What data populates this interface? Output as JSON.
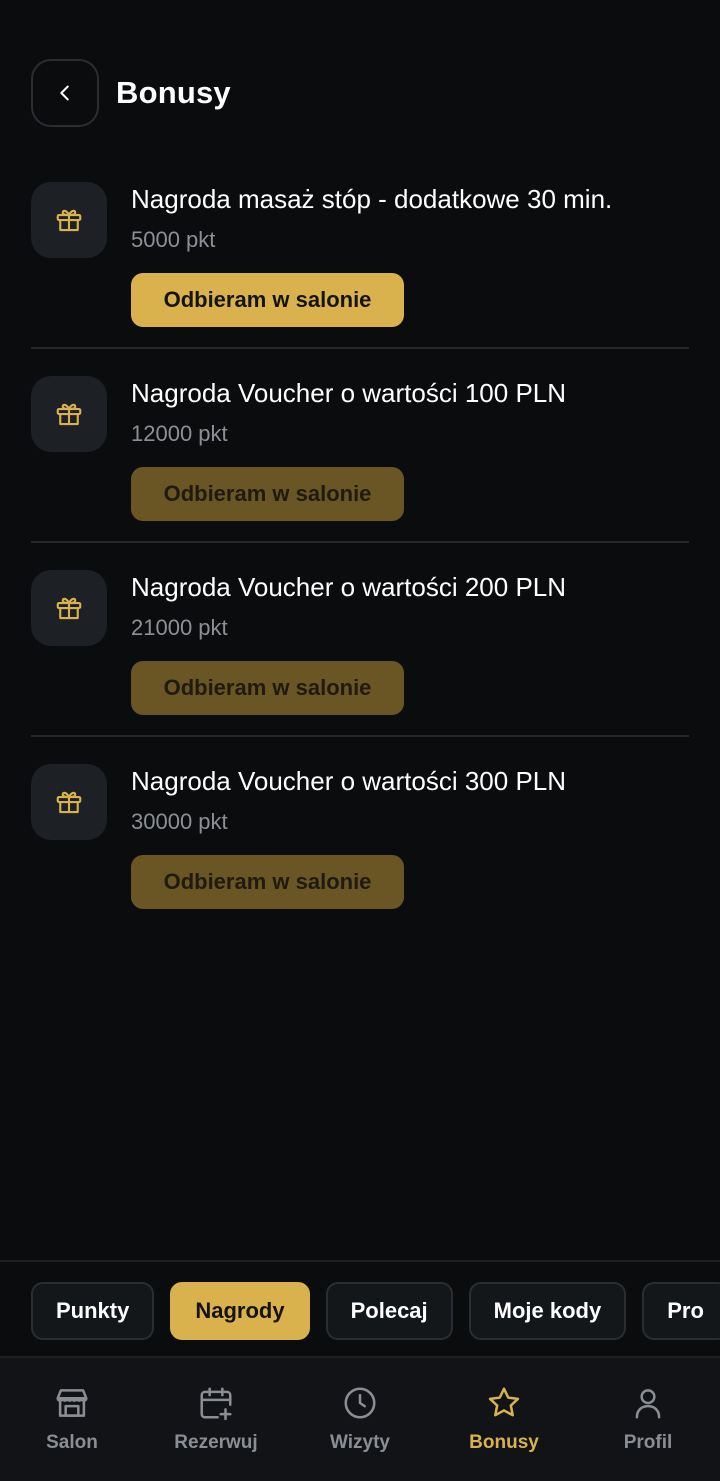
{
  "header": {
    "title": "Bonusy",
    "back_icon": "chevron-left-icon"
  },
  "rewards": [
    {
      "name": "Nagroda masaż stóp - dodatkowe 30 min.",
      "points": "5000 pkt",
      "button": "Odbieram w salonie",
      "enabled": true,
      "icon": "gift-icon"
    },
    {
      "name": "Nagroda Voucher o wartości 100 PLN",
      "points": "12000 pkt",
      "button": "Odbieram w salonie",
      "enabled": false,
      "icon": "gift-icon"
    },
    {
      "name": "Nagroda Voucher o wartości 200 PLN",
      "points": "21000 pkt",
      "button": "Odbieram w salonie",
      "enabled": false,
      "icon": "gift-icon"
    },
    {
      "name": "Nagroda Voucher o wartości 300 PLN",
      "points": "30000 pkt",
      "button": "Odbieram w salonie",
      "enabled": false,
      "icon": "gift-icon"
    }
  ],
  "tabs": [
    {
      "label": "Punkty",
      "selected": false
    },
    {
      "label": "Nagrody",
      "selected": true
    },
    {
      "label": "Polecaj",
      "selected": false
    },
    {
      "label": "Moje kody",
      "selected": false
    },
    {
      "label": "Pro",
      "selected": false
    }
  ],
  "nav": [
    {
      "label": "Salon",
      "icon": "store-icon",
      "active": false
    },
    {
      "label": "Rezerwuj",
      "icon": "calendar-plus-icon",
      "active": false
    },
    {
      "label": "Wizyty",
      "icon": "clock-icon",
      "active": false
    },
    {
      "label": "Bonusy",
      "icon": "star-icon",
      "active": true
    },
    {
      "label": "Profil",
      "icon": "user-icon",
      "active": false
    }
  ],
  "colors": {
    "background": "#0b0c0e",
    "accent": "#d9b24e",
    "accent_disabled": "#6a5624",
    "muted_text": "#8c9096"
  }
}
